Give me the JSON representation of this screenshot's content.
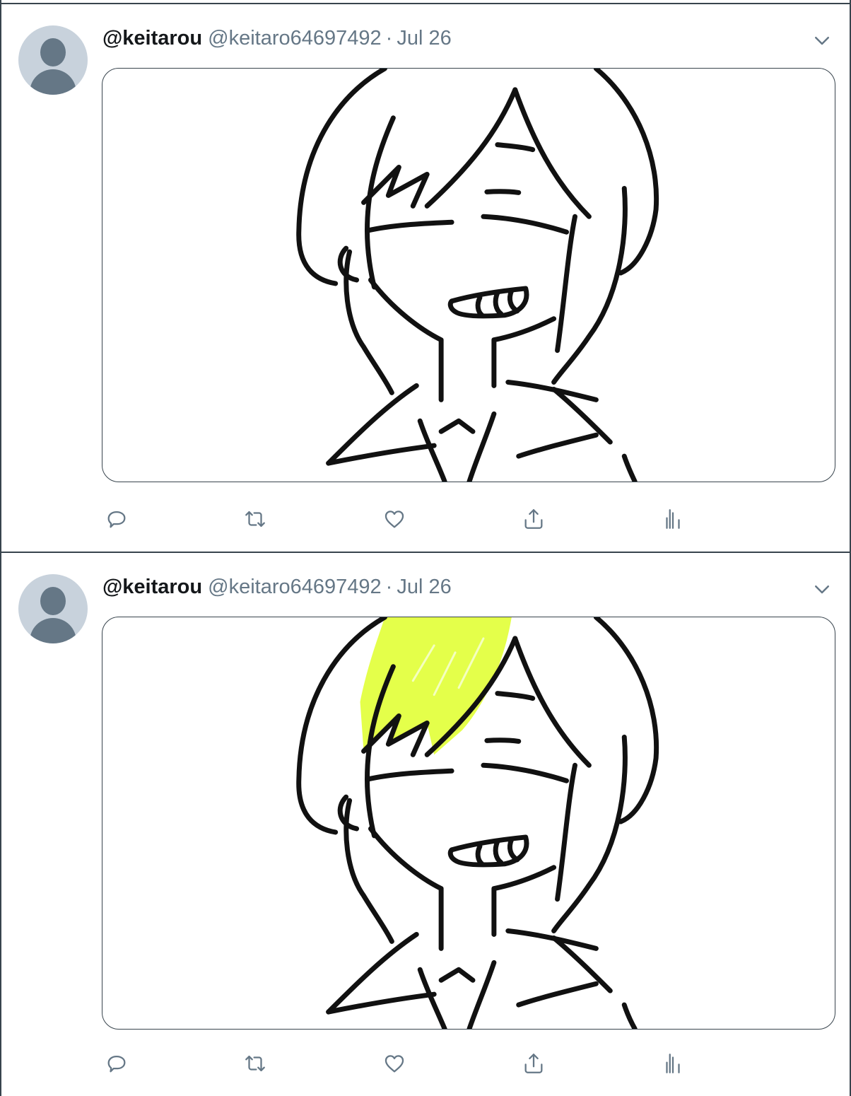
{
  "tweets": [
    {
      "display_name": "@keitarou",
      "handle": "@keitaro64697492",
      "separator": "·",
      "date": "Jul 26",
      "media": {
        "description_icon": "drawing-line-art",
        "highlight": false
      }
    },
    {
      "display_name": "@keitarou",
      "handle": "@keitaro64697492",
      "separator": "·",
      "date": "Jul 26",
      "media": {
        "description_icon": "drawing-colored-bangs",
        "highlight": true,
        "highlight_color": "#e4ff4a"
      }
    }
  ],
  "icons": {
    "reply": "reply-icon",
    "retweet": "retweet-icon",
    "like": "heart-icon",
    "share": "share-icon",
    "analytics": "analytics-icon",
    "more": "chevron-down-icon"
  },
  "colors": {
    "border": "#38444d",
    "secondary_text": "#657786",
    "icon": "#657786",
    "avatar_bg": "#c8d2dc"
  }
}
